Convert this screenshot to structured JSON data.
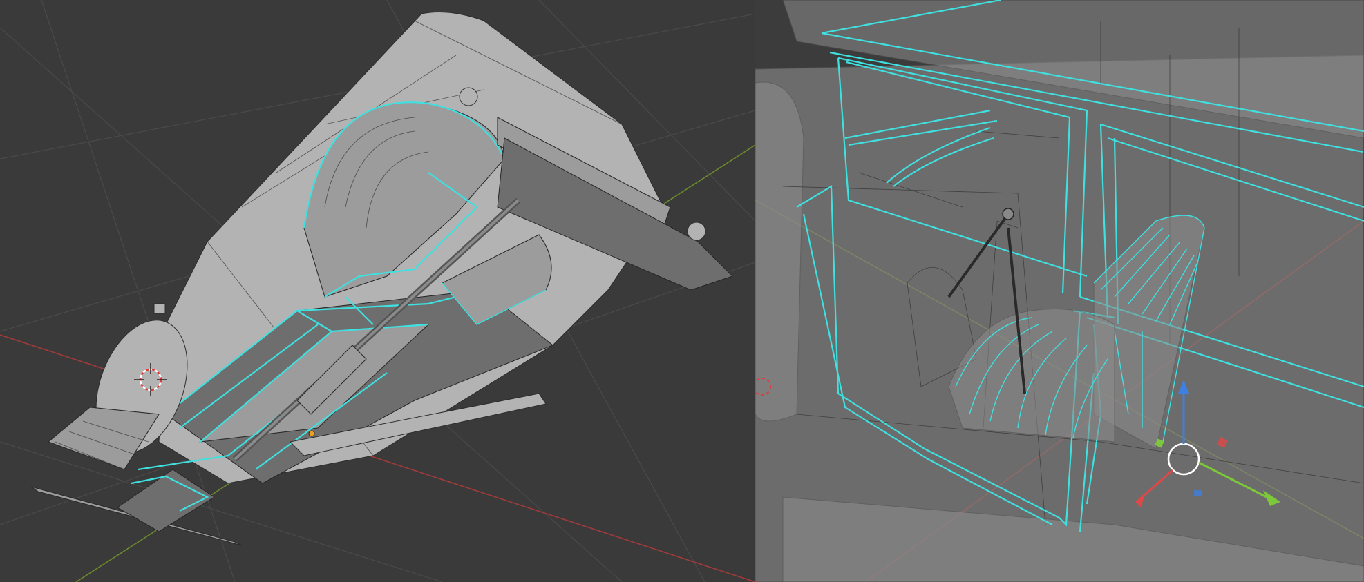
{
  "app": "Blender",
  "viewports": [
    {
      "id": "left",
      "shading": "solid",
      "selection_color": "#3fe0e0"
    },
    {
      "id": "right",
      "shading": "x-ray",
      "selection_color": "#3fe0e0"
    }
  ],
  "colors": {
    "background": "#3a3a3a",
    "grid": "#4a4a4a",
    "axis_x": "#a23a3a",
    "axis_y": "#6c8a2c",
    "gizmo_z": "#3f7fe0",
    "gizmo_y": "#7cc83a",
    "gizmo_x": "#e04848",
    "selected_edges": "#3fe0e0"
  },
  "icons": [
    "3d-cursor-icon",
    "origin-point-icon",
    "transform-gizmo-icon"
  ]
}
